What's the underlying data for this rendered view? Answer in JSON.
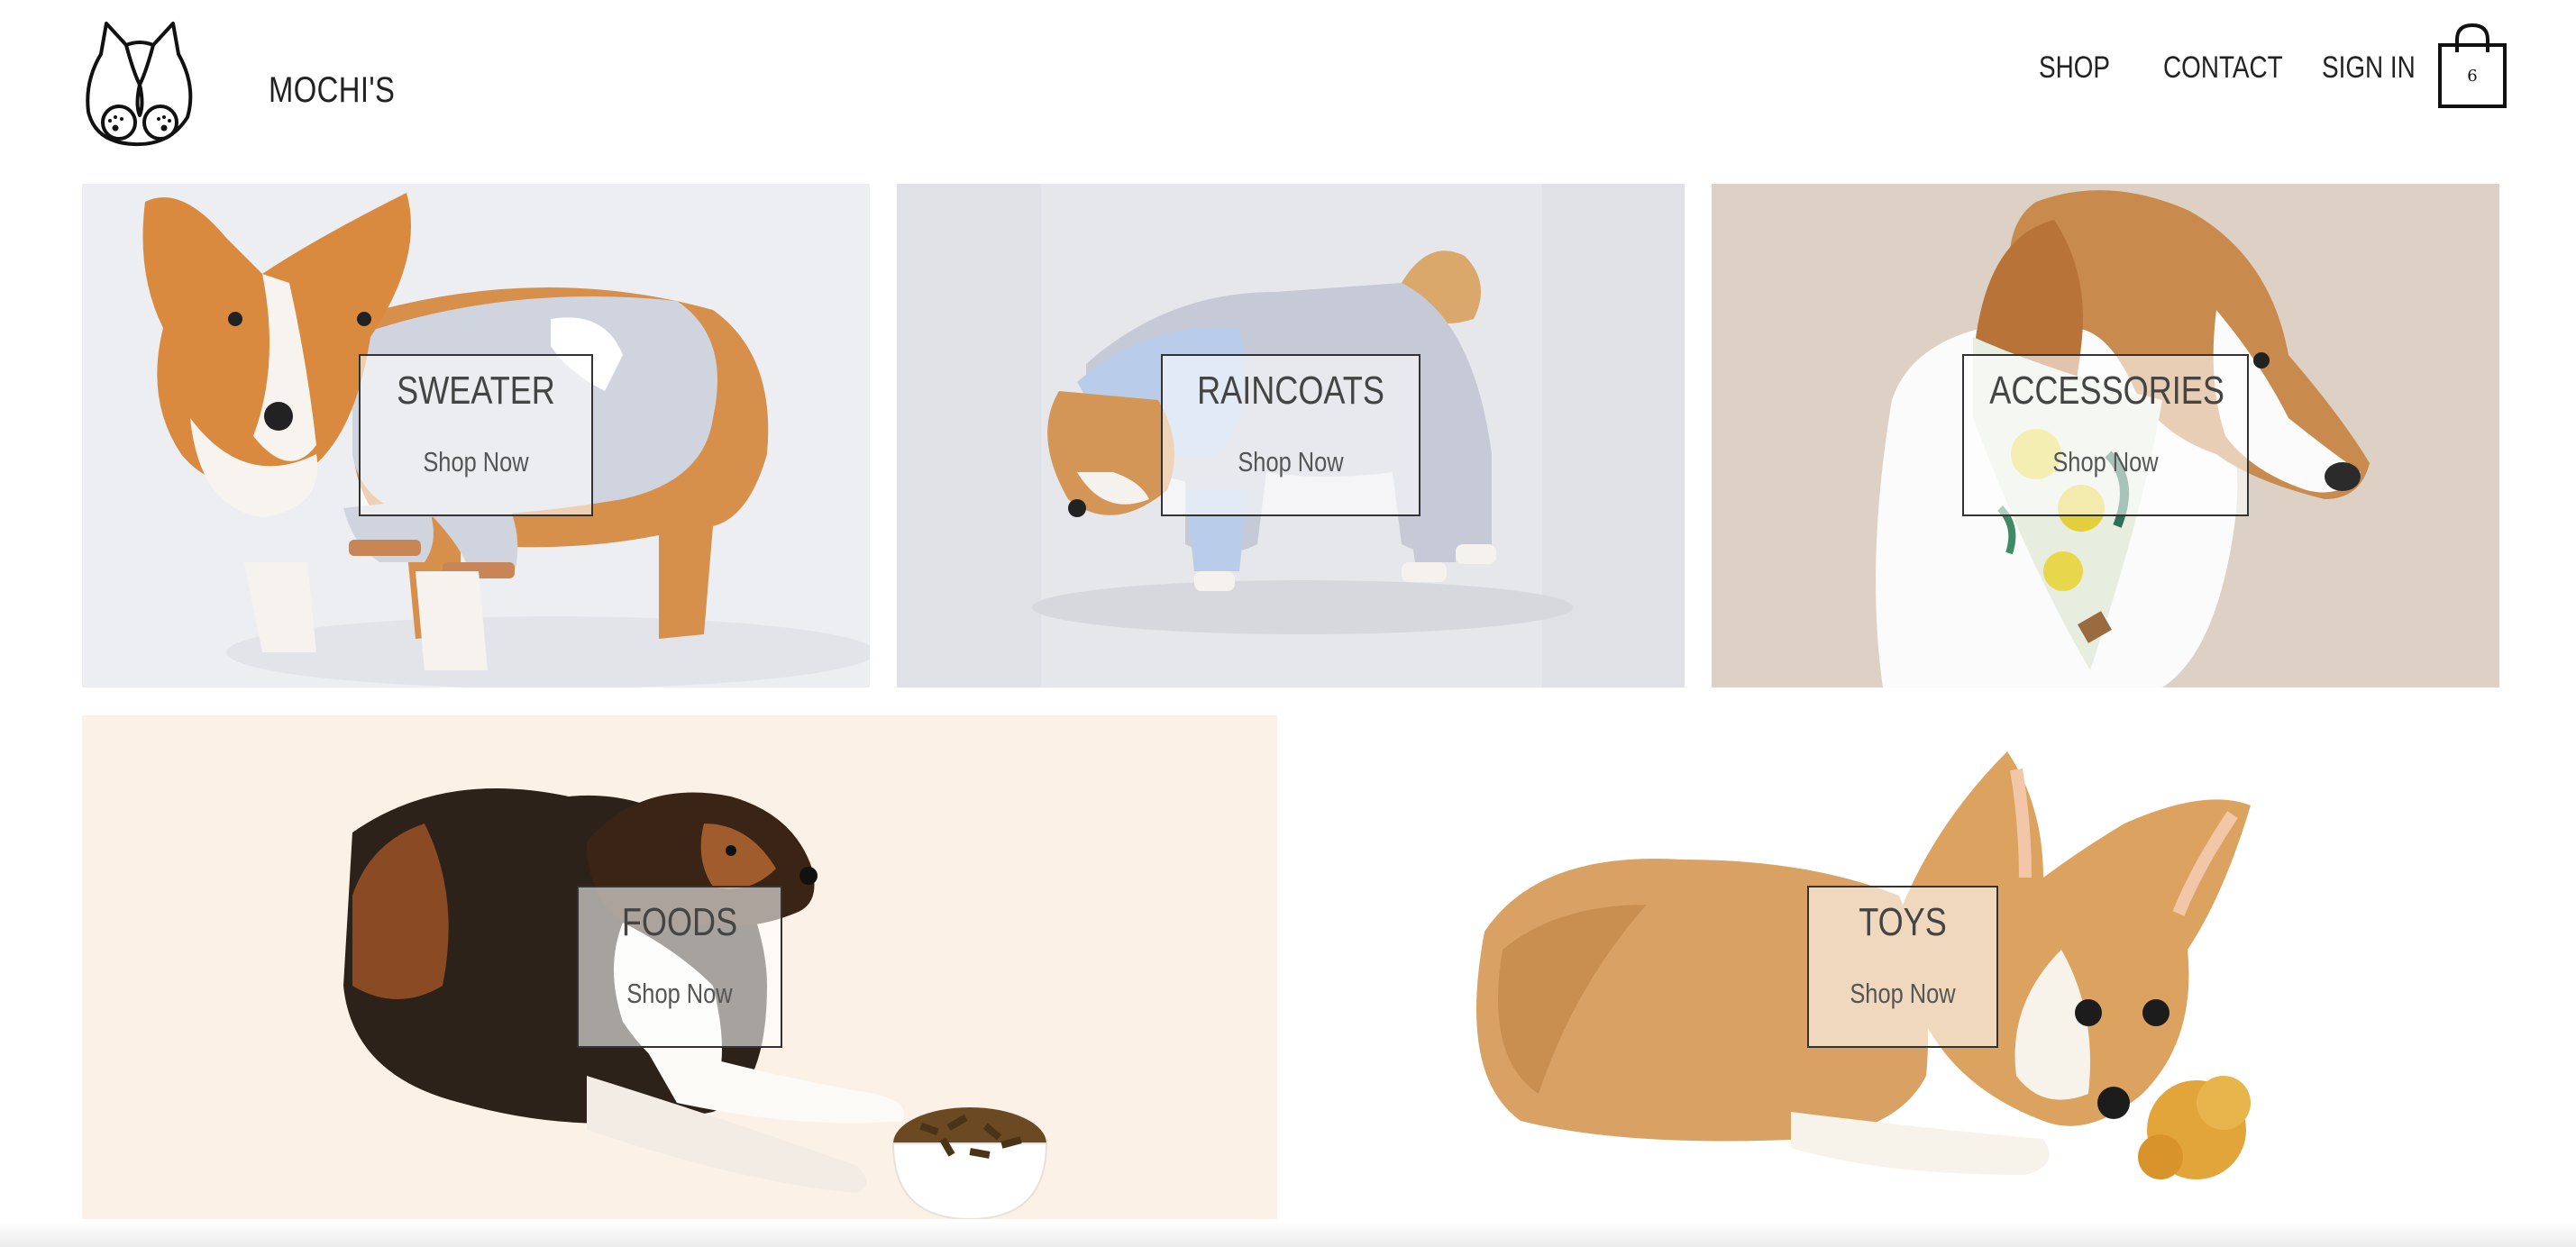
{
  "header": {
    "brand": "MOCHI'S",
    "logo_icon": "corgi-butt-logo-icon",
    "nav": [
      {
        "label": "SHOP"
      },
      {
        "label": "CONTACT"
      },
      {
        "label": "SIGN IN"
      }
    ],
    "cart": {
      "icon": "shopping-bag-icon",
      "count": "6"
    }
  },
  "categories": [
    {
      "title": "SWEATER",
      "cta": "Shop Now",
      "image": "corgi-in-sweater"
    },
    {
      "title": "RAINCOATS",
      "cta": "Shop Now",
      "image": "shiba-in-raincoat"
    },
    {
      "title": "ACCESSORIES",
      "cta": "Shop Now",
      "image": "beagle-with-lemon-bandana"
    },
    {
      "title": "FOODS",
      "cta": "Shop Now",
      "image": "collie-with-food-bowl"
    },
    {
      "title": "TOYS",
      "cta": "Shop Now",
      "image": "corgi-with-plush-toy"
    }
  ],
  "colors": {
    "text": "#222222",
    "label_border": "#333333",
    "foods_bg": "#fcf1e6",
    "accessories_bg": "#dcd1c4"
  }
}
